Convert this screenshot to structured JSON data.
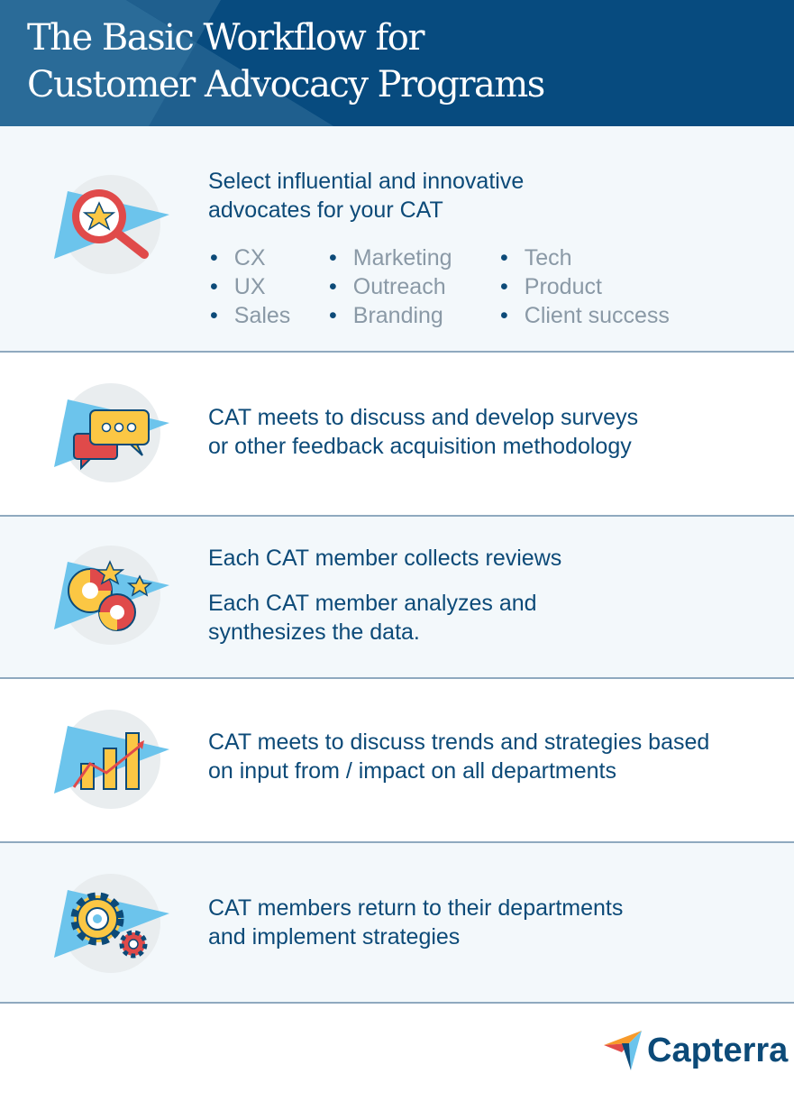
{
  "header": {
    "title_line1": "The Basic Workflow for",
    "title_line2": "Customer Advocacy Programs"
  },
  "steps": [
    {
      "icon": "magnifier-star-icon",
      "text_line1": "Select influential and innovative",
      "text_line2": "advocates for your CAT",
      "bullets": [
        "CX",
        "Marketing",
        "Tech",
        "UX",
        "Outreach",
        "Product",
        "Sales",
        "Branding",
        "Client success"
      ]
    },
    {
      "icon": "chat-bubbles-icon",
      "text_line1": "CAT meets to discuss and develop surveys",
      "text_line2": "or other feedback acquisition methodology"
    },
    {
      "icon": "pie-charts-stars-icon",
      "text_line1": "Each CAT member collects reviews",
      "text_line2": "Each CAT member analyzes and",
      "text_line3": "synthesizes the data."
    },
    {
      "icon": "bar-chart-trend-icon",
      "text_line1": "CAT meets to discuss trends and strategies based",
      "text_line2": "on input from / impact on all departments"
    },
    {
      "icon": "gears-icon",
      "text_line1": "CAT members return to their departments",
      "text_line2": "and implement strategies"
    }
  ],
  "footer": {
    "logo_text": "Capterra"
  },
  "colors": {
    "navy": "#074b7f",
    "text": "#0c4a78",
    "bullet_gray": "#8a99a6",
    "light_bg": "#f3f8fb",
    "accent_blue": "#6cc4ec",
    "red": "#e04a4a",
    "yellow": "#fbc744"
  }
}
